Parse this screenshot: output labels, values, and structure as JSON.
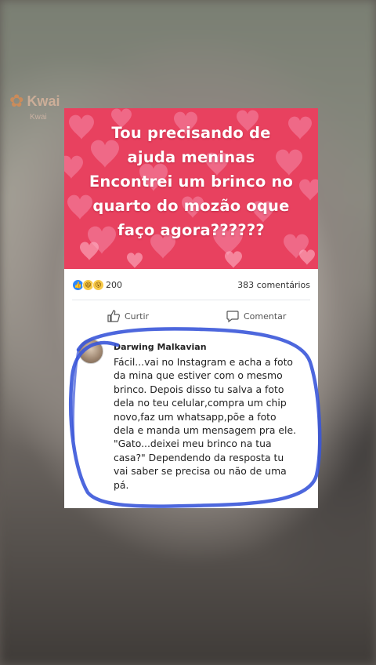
{
  "watermark": {
    "app": "Kwai",
    "sub": "Kwai"
  },
  "post": {
    "text_lines": [
      "Tou precisando de",
      "ajuda meninas",
      "Encontrei um brinco no",
      "quarto do mozão oque",
      "faço agora??????"
    ],
    "background_color": "#e8415f",
    "reaction_count": "200",
    "comments_count": "383 comentários",
    "like_label": "Curtir",
    "comment_label": "Comentar"
  },
  "comment": {
    "author": "Darwing Malkavian",
    "text": "Fácil...vai no Instagram e acha a foto\nda mina que estiver com o mesmo\nbrinco. Depois disso tu salva a foto\ndela no teu celular,compra um chip\nnovo,faz um whatsapp,põe a foto\ndela e manda um mensagem pra ele.\n\"Gato...deixei meu brinco na tua\ncasa?\" Dependendo da resposta tu\nvai saber se precisa ou não de uma\npá."
  },
  "annotation_color": "#3a56d9"
}
